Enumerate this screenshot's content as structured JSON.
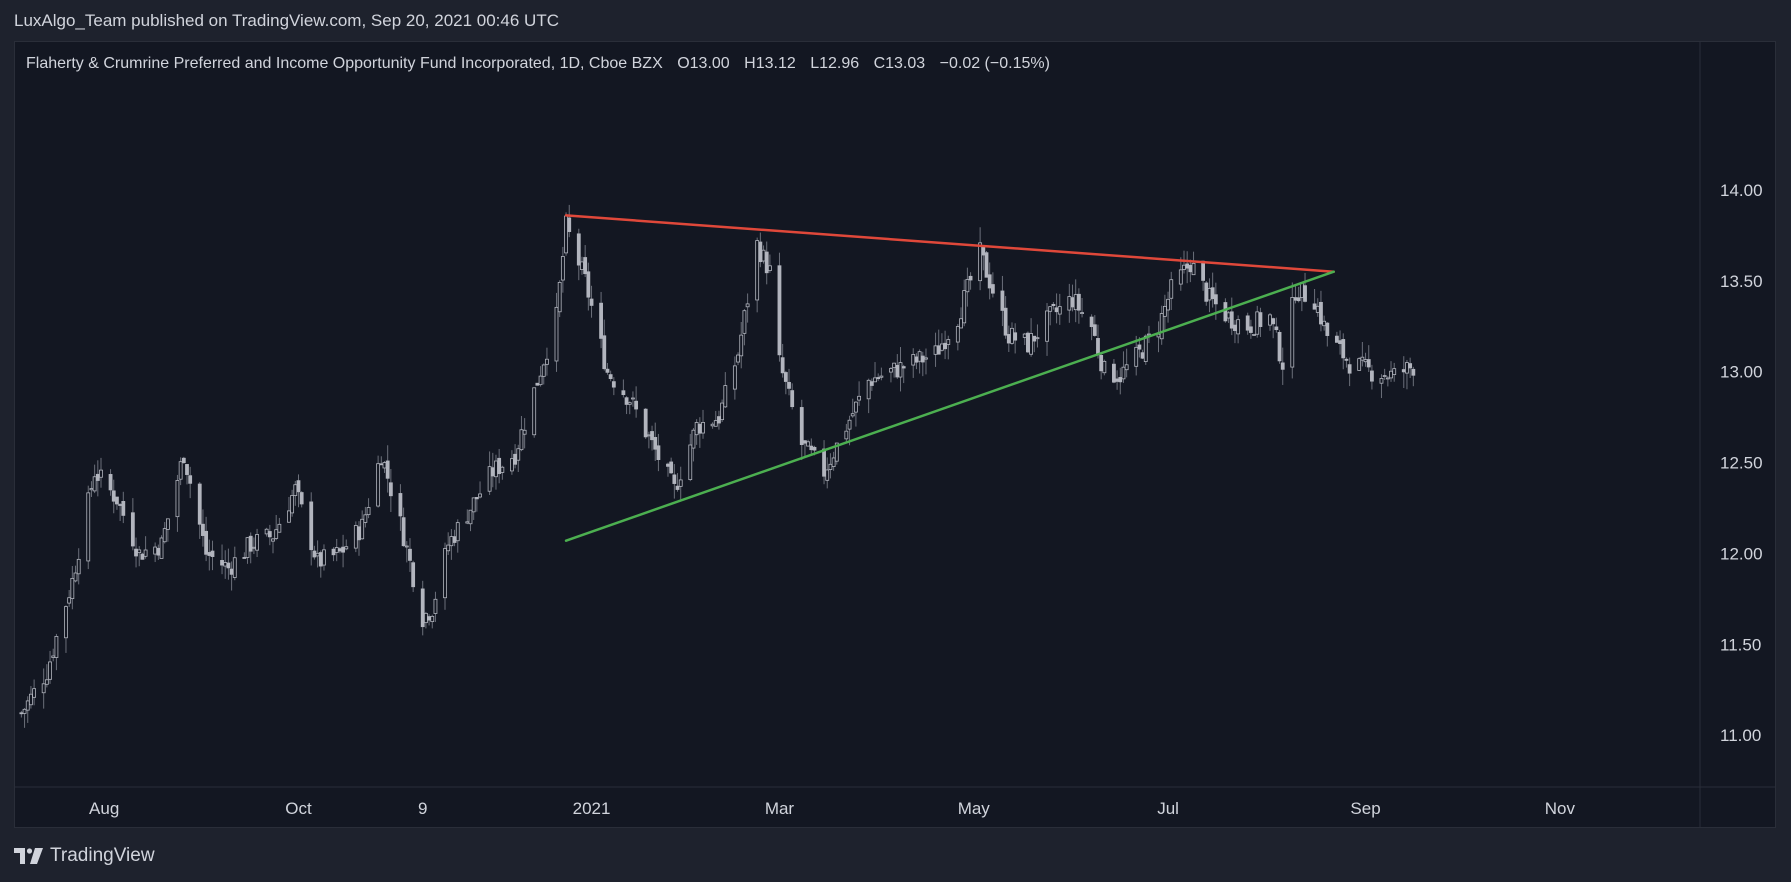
{
  "header": {
    "published_line": "LuxAlgo_Team published on TradingView.com, Sep 20, 2021 00:46 UTC"
  },
  "legend": {
    "symbol": "Flaherty & Crumrine Preferred and Income Opportunity Fund Incorporated, 1D, Cboe BZX",
    "open": "O13.00",
    "high": "H13.12",
    "low": "L12.96",
    "close": "C13.03",
    "change": "−0.02 (−0.15%)"
  },
  "footer": {
    "brand": "TradingView"
  },
  "colors": {
    "background": "#1e222d",
    "plot_background": "#131722",
    "candle": "#b2b5be",
    "resistance": "#e0483a",
    "support": "#4caf50",
    "axis_text": "#d1d4dc"
  },
  "chart_data": {
    "type": "candlestick",
    "y_ticks": [
      "14.00",
      "13.50",
      "13.00",
      "12.50",
      "12.00",
      "11.50",
      "11.00"
    ],
    "ylim": [
      10.72,
      14.55
    ],
    "x_ticks": [
      {
        "label": "Aug",
        "date": "2020-08-01"
      },
      {
        "label": "Oct",
        "date": "2020-10-01"
      },
      {
        "label": "9",
        "date": "2020-11-09"
      },
      {
        "label": "2021",
        "date": "2021-01-01"
      },
      {
        "label": "Mar",
        "date": "2021-03-01"
      },
      {
        "label": "May",
        "date": "2021-05-01"
      },
      {
        "label": "Jul",
        "date": "2021-07-01"
      },
      {
        "label": "Sep",
        "date": "2021-09-01"
      },
      {
        "label": "Nov",
        "date": "2021-11-01"
      }
    ],
    "xlim": [
      "2020-07-04",
      "2021-12-15"
    ],
    "grid": false,
    "price_path": [
      [
        "2020-07-06",
        11.12
      ],
      [
        "2020-07-14",
        11.35
      ],
      [
        "2020-07-22",
        11.85
      ],
      [
        "2020-07-29",
        12.45
      ],
      [
        "2020-08-05",
        12.3
      ],
      [
        "2020-08-12",
        12.0
      ],
      [
        "2020-08-19",
        12.05
      ],
      [
        "2020-08-26",
        12.55
      ],
      [
        "2020-09-02",
        12.0
      ],
      [
        "2020-09-09",
        11.92
      ],
      [
        "2020-09-16",
        12.05
      ],
      [
        "2020-09-23",
        12.1
      ],
      [
        "2020-09-30",
        12.35
      ],
      [
        "2020-10-07",
        11.95
      ],
      [
        "2020-10-14",
        12.0
      ],
      [
        "2020-10-21",
        12.15
      ],
      [
        "2020-10-27",
        12.55
      ],
      [
        "2020-11-03",
        12.1
      ],
      [
        "2020-11-09",
        11.65
      ],
      [
        "2020-11-12",
        11.7
      ],
      [
        "2020-11-17",
        12.05
      ],
      [
        "2020-11-24",
        12.25
      ],
      [
        "2020-12-01",
        12.45
      ],
      [
        "2020-12-08",
        12.55
      ],
      [
        "2020-12-15",
        12.95
      ],
      [
        "2020-12-21",
        13.3
      ],
      [
        "2020-12-24",
        13.8
      ],
      [
        "2020-12-30",
        13.5
      ],
      [
        "2021-01-06",
        13.0
      ],
      [
        "2021-01-13",
        12.85
      ],
      [
        "2021-01-20",
        12.6
      ],
      [
        "2021-01-27",
        12.35
      ],
      [
        "2021-02-03",
        12.7
      ],
      [
        "2021-02-10",
        12.75
      ],
      [
        "2021-02-16",
        13.1
      ],
      [
        "2021-02-22",
        13.7
      ],
      [
        "2021-02-26",
        13.55
      ],
      [
        "2021-03-01",
        13.05
      ],
      [
        "2021-03-08",
        12.6
      ],
      [
        "2021-03-15",
        12.45
      ],
      [
        "2021-03-22",
        12.7
      ],
      [
        "2021-03-29",
        12.95
      ],
      [
        "2021-04-05",
        13.0
      ],
      [
        "2021-04-12",
        13.05
      ],
      [
        "2021-04-19",
        13.1
      ],
      [
        "2021-04-26",
        13.3
      ],
      [
        "2021-05-03",
        13.65
      ],
      [
        "2021-05-07",
        13.45
      ],
      [
        "2021-05-12",
        13.2
      ],
      [
        "2021-05-18",
        13.15
      ],
      [
        "2021-05-25",
        13.3
      ],
      [
        "2021-06-01",
        13.4
      ],
      [
        "2021-06-07",
        13.25
      ],
      [
        "2021-06-11",
        13.0
      ],
      [
        "2021-06-16",
        12.98
      ],
      [
        "2021-06-22",
        13.1
      ],
      [
        "2021-06-28",
        13.25
      ],
      [
        "2021-07-02",
        13.45
      ],
      [
        "2021-07-08",
        13.6
      ],
      [
        "2021-07-14",
        13.4
      ],
      [
        "2021-07-20",
        13.3
      ],
      [
        "2021-07-26",
        13.25
      ],
      [
        "2021-08-02",
        13.3
      ],
      [
        "2021-08-06",
        13.05
      ],
      [
        "2021-08-10",
        13.45
      ],
      [
        "2021-08-16",
        13.4
      ],
      [
        "2021-08-20",
        13.2
      ],
      [
        "2021-08-27",
        13.05
      ],
      [
        "2021-09-03",
        13.0
      ],
      [
        "2021-09-10",
        12.98
      ],
      [
        "2021-09-16",
        13.03
      ]
    ],
    "trendlines": [
      {
        "role": "resistance",
        "from": {
          "date": "2020-12-24",
          "value": 13.86
        },
        "to": {
          "date": "2021-08-22",
          "value": 13.55
        }
      },
      {
        "role": "support",
        "from": {
          "date": "2020-12-24",
          "value": 12.07
        },
        "to": {
          "date": "2021-08-22",
          "value": 13.55
        }
      }
    ]
  }
}
